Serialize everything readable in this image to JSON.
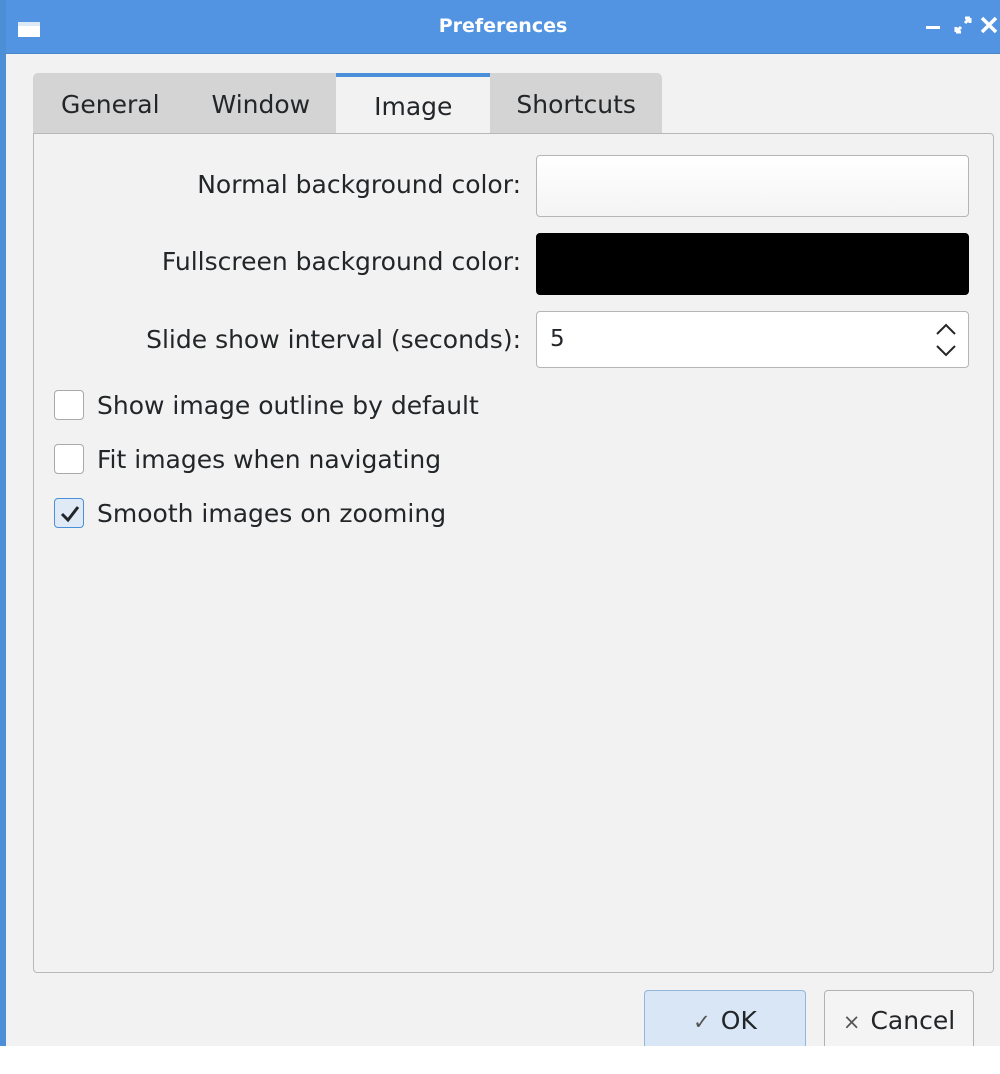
{
  "window": {
    "title": "Preferences",
    "accent_color": "#5294e2",
    "menu_icon": "window-menu-icon",
    "controls": [
      "minimize-icon",
      "maximize-icon",
      "close-icon"
    ]
  },
  "tabs": [
    {
      "label": "General",
      "active": false
    },
    {
      "label": "Window",
      "active": false
    },
    {
      "label": "Image",
      "active": true
    },
    {
      "label": "Shortcuts",
      "active": false
    }
  ],
  "form": {
    "normal_bg_label": "Normal background color:",
    "normal_bg_color": "#ffffff",
    "fullscreen_bg_label": "Fullscreen background color:",
    "fullscreen_bg_color": "#000000",
    "slideshow_label": "Slide show interval (seconds):",
    "slideshow_value": "5"
  },
  "checkboxes": [
    {
      "label": "Show image outline by default",
      "checked": false
    },
    {
      "label": "Fit images when navigating",
      "checked": false
    },
    {
      "label": "Smooth images on zooming",
      "checked": true
    }
  ],
  "buttons": {
    "ok_icon": "✓",
    "ok_label": "OK",
    "cancel_icon": "×",
    "cancel_label": "Cancel"
  }
}
